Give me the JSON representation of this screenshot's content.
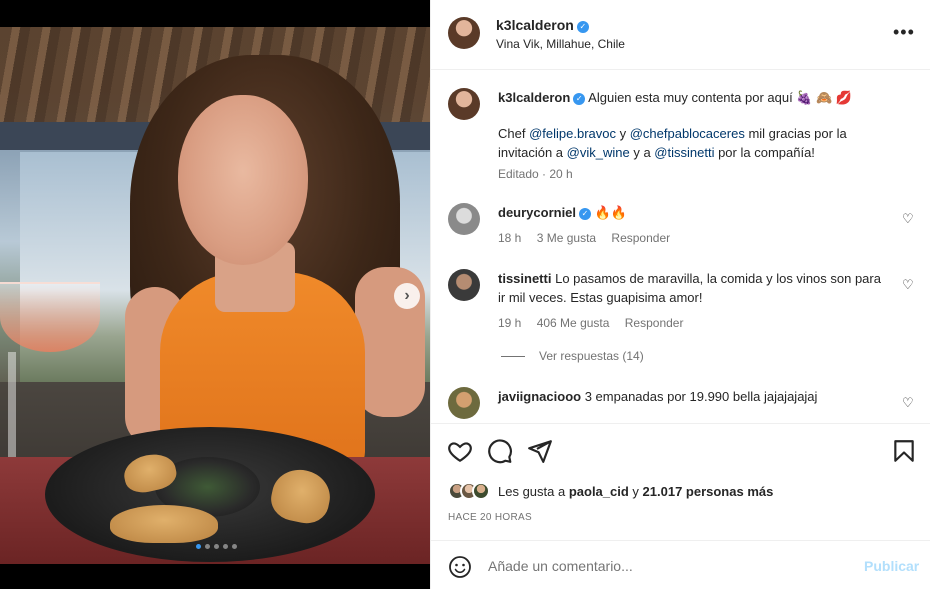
{
  "post": {
    "author": "k3lcalderon",
    "location": "Vina Vik, Millahue, Chile",
    "caption_user": "k3lcalderon",
    "caption_text": "Alguien esta muy contenta por aquí",
    "caption_emojis": "🍇 🙈 💋",
    "caption_line2": {
      "t1": "Chef ",
      "m1": "@felipe.bravoc",
      "t2": " y ",
      "m2": "@chefpablocaceres",
      "t3": " mil gracias por la invitación a ",
      "m3": "@vik_wine",
      "t4": " y a ",
      "m4": "@tissinetti",
      "t5": " por la compañía!"
    },
    "caption_meta": "Editado · 20 h"
  },
  "comments": [
    {
      "user": "deurycorniel",
      "text": "🔥🔥",
      "time": "18 h",
      "likes": "3 Me gusta",
      "reply": "Responder"
    },
    {
      "user": "tissinetti",
      "text": "Lo pasamos de maravilla, la comida y los vinos son para ir mil veces. Estas guapisima amor!",
      "time": "19 h",
      "likes": "406 Me gusta",
      "reply": "Responder"
    },
    {
      "user": "javiignaciooo",
      "text": "3 empanadas por 19.990 bella jajajajajaj",
      "time": "",
      "likes": "",
      "reply": ""
    }
  ],
  "view_replies": "Ver respuestas (14)",
  "likes": {
    "prefix": "Les gusta a ",
    "user": "paola_cid",
    "middle": " y ",
    "count": "21.017 personas más"
  },
  "time_ago": "HACE 20 HORAS",
  "add_comment": {
    "placeholder": "Añade un comentario...",
    "post_label": "Publicar"
  },
  "carousel": {
    "total": 5,
    "active": 1
  }
}
